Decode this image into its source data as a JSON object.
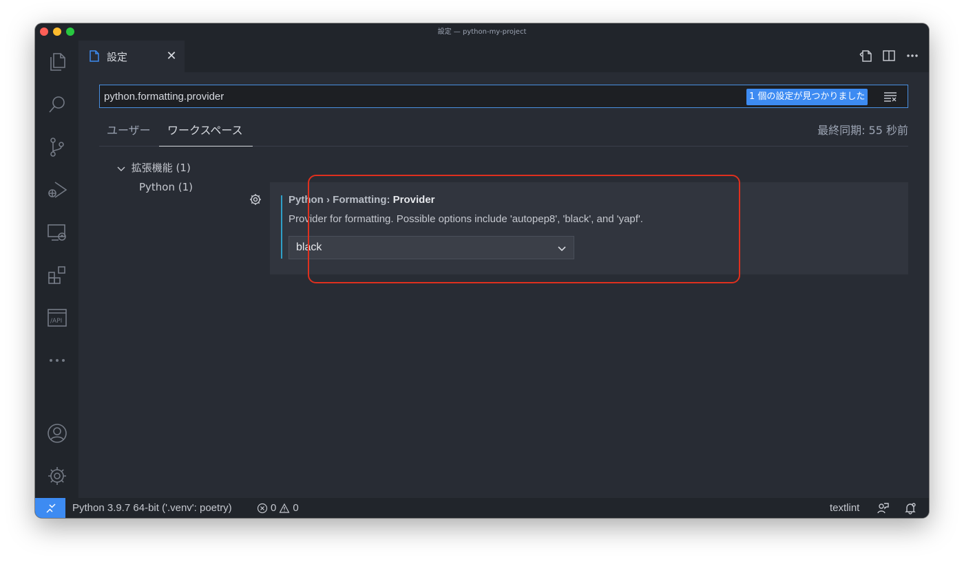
{
  "window": {
    "title": "設定 — python-my-project"
  },
  "activity_bar": {
    "items": [
      {
        "icon": "files-icon"
      },
      {
        "icon": "search-icon"
      },
      {
        "icon": "source-control-icon"
      },
      {
        "icon": "run-debug-icon"
      },
      {
        "icon": "remote-explorer-icon"
      },
      {
        "icon": "extensions-icon"
      },
      {
        "icon": "api-icon"
      },
      {
        "icon": "more-icon"
      },
      {
        "icon": "account-icon"
      },
      {
        "icon": "manage-gear-icon"
      }
    ]
  },
  "tab": {
    "label": "設定",
    "close": "✕"
  },
  "search": {
    "value": "python.formatting.provider",
    "result_count": "1 個の設定が見つかりました"
  },
  "scope_tabs": {
    "user": "ユーザー",
    "workspace": "ワークスペース",
    "active": "workspace"
  },
  "last_sync": "最終同期: 55 秒前",
  "toc": {
    "group": "拡張機能 (1)",
    "child": "Python (1)"
  },
  "setting": {
    "category": "Python › Formatting: ",
    "name": "Provider",
    "description": "Provider for formatting. Possible options include 'autopep8', 'black', and 'yapf'.",
    "value": "black"
  },
  "status_bar": {
    "python": "Python 3.9.7 64-bit ('.venv': poetry)",
    "errors": "0",
    "warnings": "0",
    "textlint": "textlint",
    "accent": "#3d8bf2"
  }
}
